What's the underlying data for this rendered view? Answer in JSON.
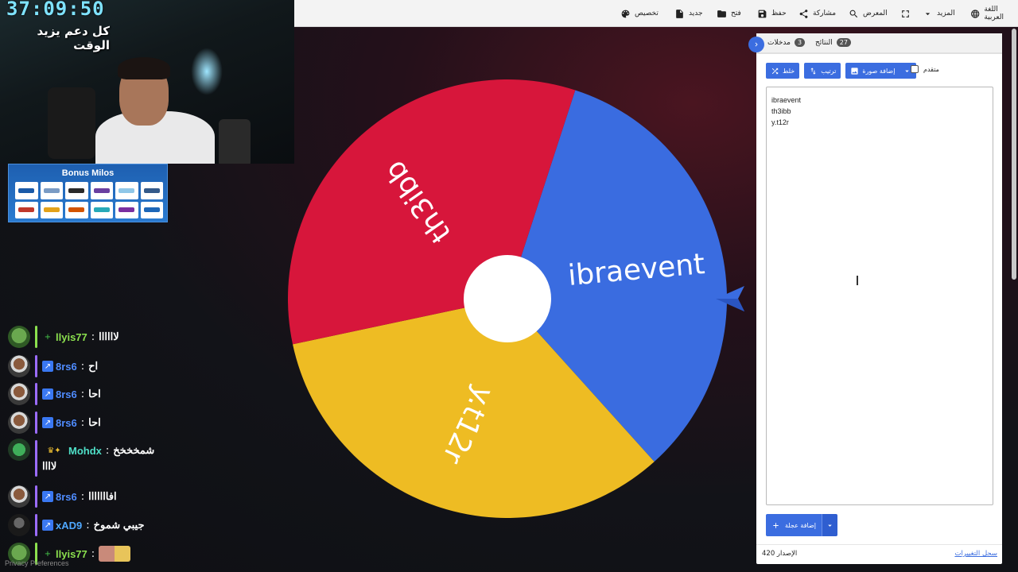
{
  "colors": {
    "accent": "#3b6de0",
    "wheel_red": "#d7163b",
    "wheel_blue": "#3a6ce0",
    "wheel_yellow": "#eebc23",
    "timer": "#7fe3ff"
  },
  "toolbar": {
    "items": [
      {
        "label": "اللغة العربية",
        "icon": "globe-icon"
      },
      {
        "label": "المزيد",
        "icon": "chevron-down-icon"
      },
      {
        "label": "",
        "icon": "fullscreen-icon"
      },
      {
        "label": "المعرض",
        "icon": "search-icon"
      },
      {
        "label": "مشاركة",
        "icon": "share-icon"
      },
      {
        "label": "حفظ",
        "icon": "save-icon"
      },
      {
        "label": "فتح",
        "icon": "folder-icon"
      },
      {
        "label": "جديد",
        "icon": "file-icon"
      },
      {
        "label": "تخصيص",
        "icon": "palette-icon"
      }
    ]
  },
  "stream": {
    "timer": "37:09:50",
    "caption": "كل دعم يزيد الوقت",
    "sponsor_title": "Bonus Milos",
    "sponsor_logos": [
      "SNB",
      "riyad",
      "alrajhi",
      "mada",
      "stc",
      "bank",
      "sab",
      "lay",
      "boxes",
      "anb",
      "rain",
      "amex"
    ]
  },
  "chat": [
    {
      "user": "llyis77",
      "msg": "لاااااا",
      "name_color": "#8be04e",
      "badge": "+",
      "badge_color": "#45c94a",
      "avatar": "frog",
      "bar": "#8be04e"
    },
    {
      "user": "8rs6",
      "msg": "اح",
      "name_color": "#4f8cff",
      "badge": "↗",
      "badge_color": "#3a78f2",
      "avatar": "face",
      "bar": "#9b6cff"
    },
    {
      "user": "8rs6",
      "msg": "احا",
      "name_color": "#4f8cff",
      "badge": "↗",
      "badge_color": "#3a78f2",
      "avatar": "face",
      "bar": "#9b6cff"
    },
    {
      "user": "8rs6",
      "msg": "احا",
      "name_color": "#4f8cff",
      "badge": "↗",
      "badge_color": "#3a78f2",
      "avatar": "face",
      "bar": "#9b6cff"
    },
    {
      "user": "Mohdx",
      "msg": "شمخخخخ",
      "msg2": "لاااا",
      "name_color": "#4fe0c8",
      "badge": "♛✦",
      "badge_color": "#f2c233",
      "avatar": "green",
      "bar": "#9b6cff"
    },
    {
      "user": "8rs6",
      "msg": "افااااااا",
      "name_color": "#4f8cff",
      "badge": "↗",
      "badge_color": "#3a78f2",
      "avatar": "face",
      "bar": "#9b6cff"
    },
    {
      "user": "xAD9",
      "msg": "جيبي شموخ",
      "name_color": "#4fa8ff",
      "badge": "↗",
      "badge_color": "#3a78f2",
      "avatar": "dark",
      "bar": "#9b6cff"
    },
    {
      "user": "llyis77",
      "msg": "",
      "name_color": "#8be04e",
      "badge": "+",
      "badge_color": "#45c94a",
      "avatar": "frog",
      "bar": "#8be04e"
    }
  ],
  "privacy": "Privacy Preferences",
  "wheel": {
    "segments": [
      {
        "label": "ibraevent",
        "color": "#3a6ce0"
      },
      {
        "label": "y.t12r",
        "color": "#eebc23"
      },
      {
        "label": "th3ibb",
        "color": "#d7163b"
      }
    ]
  },
  "panel": {
    "tab_entries_label": "مدخلات",
    "tab_entries_count": "3",
    "tab_results_label": "النتائج",
    "tab_results_count": "27",
    "shuffle_label": "خلط",
    "sort_label": "ترتيب",
    "add_image_label": "إضافة صورة",
    "advanced_label": "متقدم",
    "entries": [
      "ibraevent",
      "th3ibb",
      "y.t12r"
    ],
    "add_wheel_label": "إضافة عجلة",
    "version": "الإصدار 420",
    "changelog": "سجل التغييرات"
  }
}
